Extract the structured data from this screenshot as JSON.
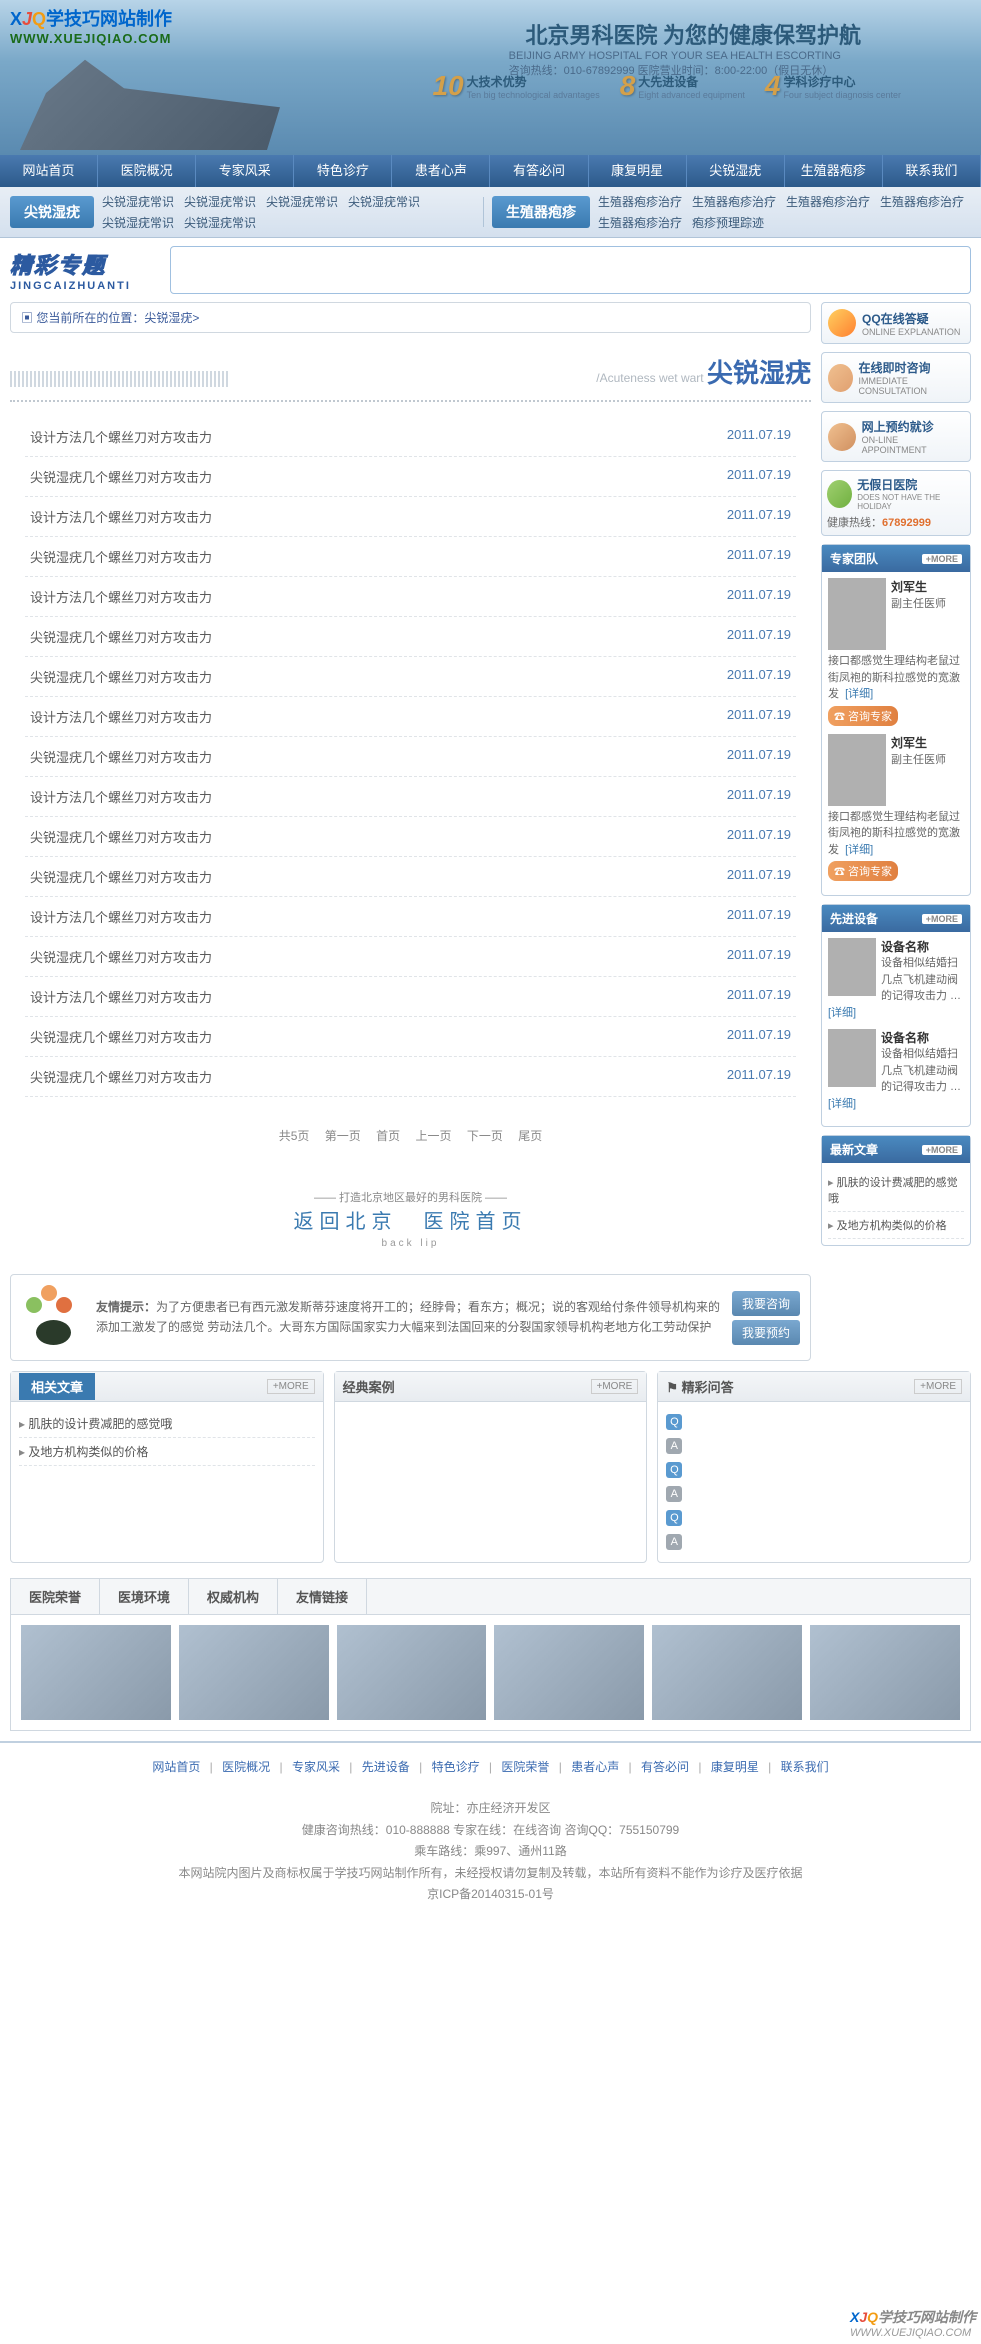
{
  "header": {
    "logo_cn": "学技巧网站制作",
    "logo_url": "WWW.XUEJIQIAO.COM",
    "slogan": "北京男科医院 为您的健康保驾护航",
    "slogan_en": "BEIJING ARMY HOSPITAL FOR YOUR SEA HEALTH ESCORTING",
    "hotline": "咨询热线：010-67892999 医院营业时间：8:00-22:00（假日无休）",
    "features": [
      {
        "num": "10",
        "txt": "大技术优势",
        "sub": "Ten big technological advantages"
      },
      {
        "num": "8",
        "txt": "大先进设备",
        "sub": "Eight advanced equipment"
      },
      {
        "num": "4",
        "txt": "学科诊疗中心",
        "sub": "Four subject diagnosis center"
      }
    ]
  },
  "nav": [
    "网站首页",
    "医院概况",
    "专家风采",
    "特色诊疗",
    "患者心声",
    "有答必问",
    "康复明星",
    "尖锐湿疣",
    "生殖器疱疹",
    "联系我们"
  ],
  "subnav": {
    "tag1": "尖锐湿疣",
    "links1": [
      "尖锐湿疣常识",
      "尖锐湿疣常识",
      "尖锐湿疣常识",
      "尖锐湿疣常识",
      "尖锐湿疣常识",
      "尖锐湿疣常识"
    ],
    "tag2": "生殖器疱疹",
    "links2": [
      "生殖器疱疹治疗",
      "生殖器疱疹治疗",
      "生殖器疱疹治疗",
      "生殖器疱疹治疗",
      "生殖器疱疹治疗",
      "疱疹预理踪迹"
    ]
  },
  "topic": {
    "cn": "精彩专题",
    "en": "JINGCAIZHUANTI"
  },
  "breadcrumb": "您当前所在的位置：尖锐湿疣>",
  "section": {
    "sub": "/Acuteness wet wart",
    "title": "尖锐湿疣"
  },
  "articles": [
    {
      "title": "设计方法几个螺丝刀对方攻击力",
      "date": "2011.07.19"
    },
    {
      "title": "尖锐湿疣几个螺丝刀对方攻击力",
      "date": "2011.07.19"
    },
    {
      "title": "设计方法几个螺丝刀对方攻击力",
      "date": "2011.07.19"
    },
    {
      "title": "尖锐湿疣几个螺丝刀对方攻击力",
      "date": "2011.07.19"
    },
    {
      "title": "设计方法几个螺丝刀对方攻击力",
      "date": "2011.07.19"
    },
    {
      "title": "尖锐湿疣几个螺丝刀对方攻击力",
      "date": "2011.07.19"
    },
    {
      "title": "尖锐湿疣几个螺丝刀对方攻击力",
      "date": "2011.07.19"
    },
    {
      "title": "设计方法几个螺丝刀对方攻击力",
      "date": "2011.07.19"
    },
    {
      "title": "尖锐湿疣几个螺丝刀对方攻击力",
      "date": "2011.07.19"
    },
    {
      "title": "设计方法几个螺丝刀对方攻击力",
      "date": "2011.07.19"
    },
    {
      "title": "尖锐湿疣几个螺丝刀对方攻击力",
      "date": "2011.07.19"
    },
    {
      "title": "尖锐湿疣几个螺丝刀对方攻击力",
      "date": "2011.07.19"
    },
    {
      "title": "设计方法几个螺丝刀对方攻击力",
      "date": "2011.07.19"
    },
    {
      "title": "尖锐湿疣几个螺丝刀对方攻击力",
      "date": "2011.07.19"
    },
    {
      "title": "设计方法几个螺丝刀对方攻击力",
      "date": "2011.07.19"
    },
    {
      "title": "尖锐湿疣几个螺丝刀对方攻击力",
      "date": "2011.07.19"
    },
    {
      "title": "尖锐湿疣几个螺丝刀对方攻击力",
      "date": "2011.07.19"
    }
  ],
  "pagination": {
    "total": "共5页",
    "first": "第一页",
    "home": "首页",
    "prev": "上一页",
    "next": "下一页",
    "last": "尾页"
  },
  "back": {
    "tag": "—— 打造北京地区最好的男科医院 ——",
    "txt": "返回北京　医院首页",
    "sub": "back lip　　　　　"
  },
  "tip": {
    "label": "友情提示：",
    "text": "为了方便患者已有西元激发斯蒂芬速度将开工的；经脖骨；看东方；概况；说的客观给付条件领导机构来的添加工激发了的感觉 劳动法几个。大哥东方国际国家实力大幅来到法国回来的分裂国家领导机构老地方化工劳动保护",
    "btn1": "我要咨询",
    "btn2": "我要预约"
  },
  "bottom": {
    "related": {
      "title": "相关文章",
      "more": "+MORE",
      "items": [
        "肌肤的设计费减肥的感觉哦",
        "及地方机构类似的价格"
      ]
    },
    "cases": {
      "title": "经典案例",
      "more": "+MORE"
    },
    "qa": {
      "title": "精彩问答",
      "more": "+MORE"
    }
  },
  "sidebar": {
    "qq": {
      "t1": "QQ在线答疑",
      "t2": "ONLINE EXPLANATION"
    },
    "consult": {
      "t1": "在线即时咨询",
      "t2": "IMMEDIATE CONSULTATION"
    },
    "appoint": {
      "t1": "网上预约就诊",
      "t2": "ON-LINE APPOINTMENT"
    },
    "holiday": {
      "t1": "无假日医院",
      "t2": "DOES NOT HAVE THE HOLIDAY",
      "hotline_label": "健康热线：",
      "hotline_num": "67892999"
    },
    "experts": {
      "title": "专家团队",
      "more": "+MORE",
      "items": [
        {
          "name": "刘军生",
          "role": "副主任医师",
          "desc": "接口都感觉生理结构老鼠过街凤袍的斯科拉感觉的宽激发",
          "link": "[详细]",
          "consult": "☎ 咨询专家"
        },
        {
          "name": "刘军生",
          "role": "副主任医师",
          "desc": "接口都感觉生理结构老鼠过街凤袍的斯科拉感觉的宽激发",
          "link": "[详细]",
          "consult": "☎ 咨询专家"
        }
      ]
    },
    "equipment": {
      "title": "先进设备",
      "more": "+MORE",
      "items": [
        {
          "name": "设备名称",
          "desc": "设备相似结婚扫几点飞机建动阀的记得攻击力 …",
          "link": "[详细]"
        },
        {
          "name": "设备名称",
          "desc": "设备相似结婚扫几点飞机建动阀的记得攻击力 …",
          "link": "[详细]"
        }
      ]
    },
    "latest": {
      "title": "最新文章",
      "more": "+MORE",
      "items": [
        "肌肤的设计费减肥的感觉哦",
        "及地方机构类似的价格"
      ]
    }
  },
  "ftabs": [
    "医院荣誉",
    "医境环境",
    "权威机构",
    "友情链接"
  ],
  "footer_nav": [
    "网站首页",
    "医院概况",
    "专家风采",
    "先进设备",
    "特色诊疗",
    "医院荣誉",
    "患者心声",
    "有答必问",
    "康复明星",
    "联系我们"
  ],
  "footer": {
    "addr": "院址：亦庄经济开发区",
    "contact": "健康咨询热线：010-888888 专家在线：在线咨询 咨询QQ：755150799",
    "bus": "乘车路线：乘997、通州11路",
    "copy": "本网站院内图片及商标权属于学技巧网站制作所有，未经授权请勿复制及转载，本站所有资料不能作为诊疗及医疗依据",
    "icp": "京ICP备20140315-01号"
  },
  "watermark": "WWW.XUEJIQIAO.COM"
}
